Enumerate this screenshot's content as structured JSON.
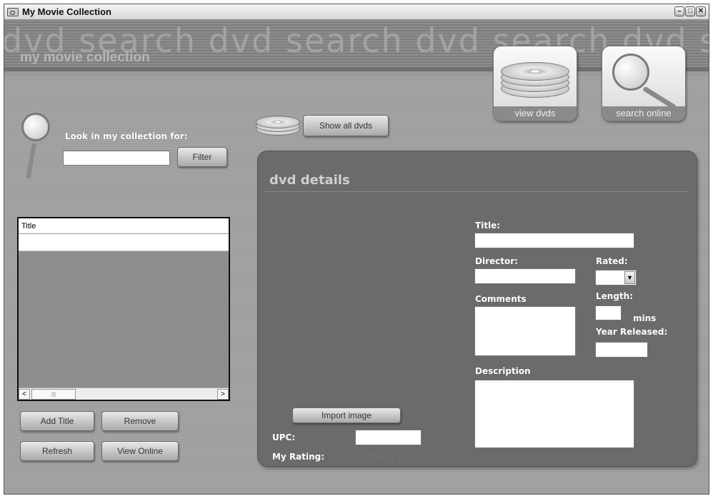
{
  "window": {
    "title": "My Movie Collection",
    "controls": [
      "–",
      "□",
      "✕"
    ]
  },
  "banner": {
    "watermark": "dvd search dvd search dvd search dvd search",
    "subtitle": "my movie collection"
  },
  "nav": {
    "view_dvds": "view dvds",
    "search_online": "search online",
    "show_all": "Show all dvds"
  },
  "filter": {
    "label": "Look in my collection for:",
    "value": "",
    "button": "Filter"
  },
  "list": {
    "column": "Title",
    "rows": [
      ""
    ],
    "scroll_left": "<",
    "scroll_right": ">",
    "scroll_thumb": "|||"
  },
  "list_buttons": {
    "add": "Add Title",
    "remove": "Remove",
    "refresh": "Refresh",
    "view_online": "View Online"
  },
  "details": {
    "heading": "dvd details",
    "title_label": "Title:",
    "title_value": "",
    "director_label": "Director:",
    "director_value": "",
    "rated_label": "Rated:",
    "rated_value": "",
    "comments_label": "Comments",
    "comments_value": "",
    "length_label": "Length:",
    "length_value": "",
    "length_unit": "mins",
    "year_label": "Year Released:",
    "year_value": "",
    "description_label": "Description",
    "description_value": "",
    "import_button": "Import image",
    "upc_label": "UPC:",
    "upc_value": "",
    "rating_label": "My Rating:",
    "rating_stars": "☆☆☆☆☆"
  }
}
